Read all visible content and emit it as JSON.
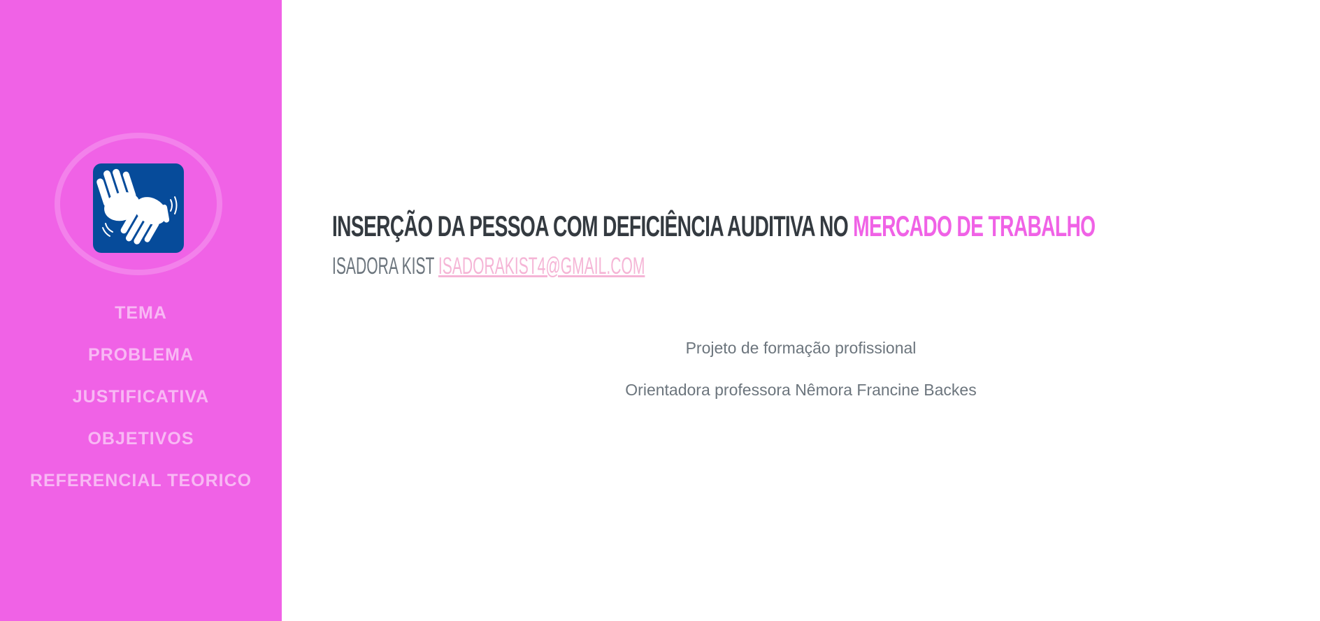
{
  "sidebar": {
    "logo_icon": "sign-language-hands-icon",
    "nav": [
      {
        "label": "TEMA"
      },
      {
        "label": "PROBLEMA"
      },
      {
        "label": "JUSTIFICATIVA"
      },
      {
        "label": "OBJETIVOS"
      },
      {
        "label": "REFERENCIAL TEORICO"
      }
    ]
  },
  "main": {
    "title_main": "INSERÇÃO DA PESSOA COM DEFICIÊNCIA AUDITIVA NO",
    "title_accent": "MERCADO DE TRABALHO",
    "author": "ISADORA KIST",
    "email": "ISADORAKIST4@GMAIL.COM",
    "lead_1": "Projeto de formação profissional",
    "lead_2": "Orientadora professora Nêmora Francine Backes"
  },
  "colors": {
    "sidebar_bg": "#f062e6",
    "accent": "#f062e6",
    "heading_text": "#343a40",
    "muted_text": "#6c757d",
    "email_link": "#f5b5d6",
    "logo_bg": "#064b9a"
  }
}
